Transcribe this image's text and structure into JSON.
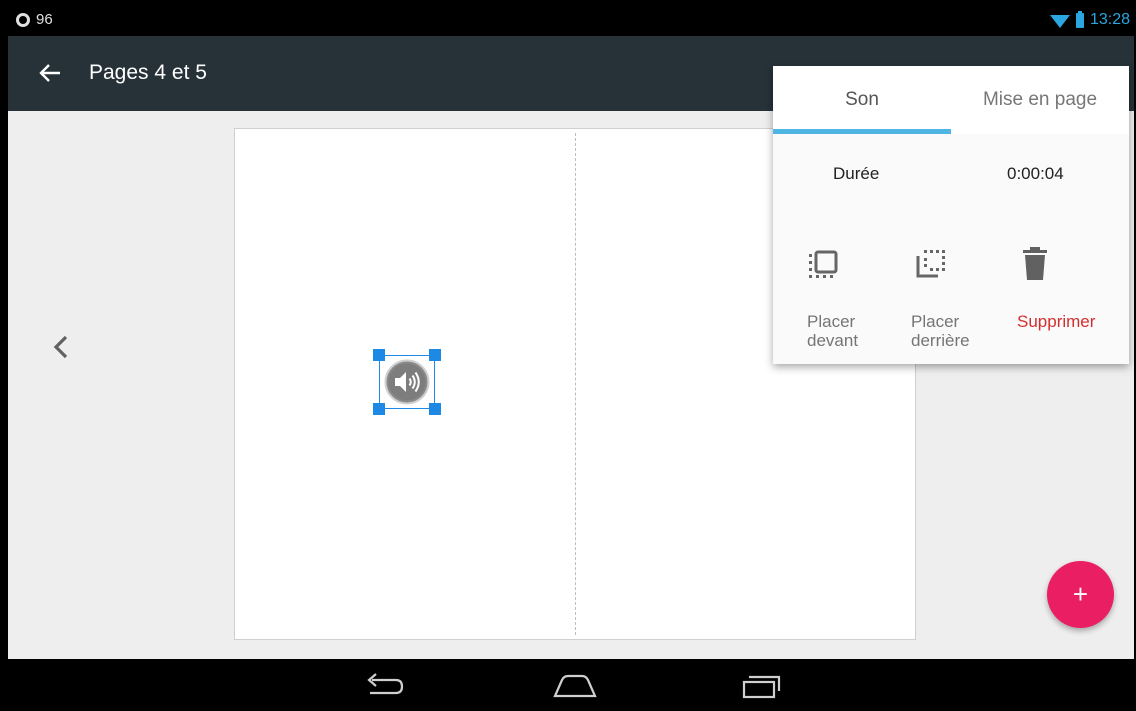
{
  "status_bar": {
    "notification_count": "96",
    "time": "13:28"
  },
  "app_bar": {
    "title": "Pages 4 et 5"
  },
  "popup": {
    "tabs": [
      {
        "label": "Son",
        "active": true
      },
      {
        "label": "Mise en page",
        "active": false
      }
    ],
    "duration": {
      "label": "Durée",
      "value": "0:00:04"
    },
    "actions": [
      {
        "label_line1": "Placer",
        "label_line2": "devant"
      },
      {
        "label_line1": "Placer",
        "label_line2": "derrière"
      },
      {
        "label": "Supprimer"
      }
    ]
  },
  "fab": {
    "label": "+"
  },
  "colors": {
    "app_bar": "#263238",
    "tab_indicator": "#4fb6e3",
    "selection": "#1e88e5",
    "fab": "#e91e63",
    "delete": "#d32f2f",
    "status_accent": "#2aa6e0"
  },
  "icons": {
    "status": [
      "notification-circle-icon",
      "wifi-icon",
      "battery-icon"
    ],
    "app_bar": [
      "back-arrow-icon"
    ],
    "content": [
      "chevron-left-icon",
      "speaker-icon"
    ],
    "popup": [
      "bring-front-icon",
      "send-back-icon",
      "trash-icon"
    ],
    "nav": [
      "nav-back-icon",
      "nav-home-icon",
      "nav-recents-icon"
    ]
  }
}
